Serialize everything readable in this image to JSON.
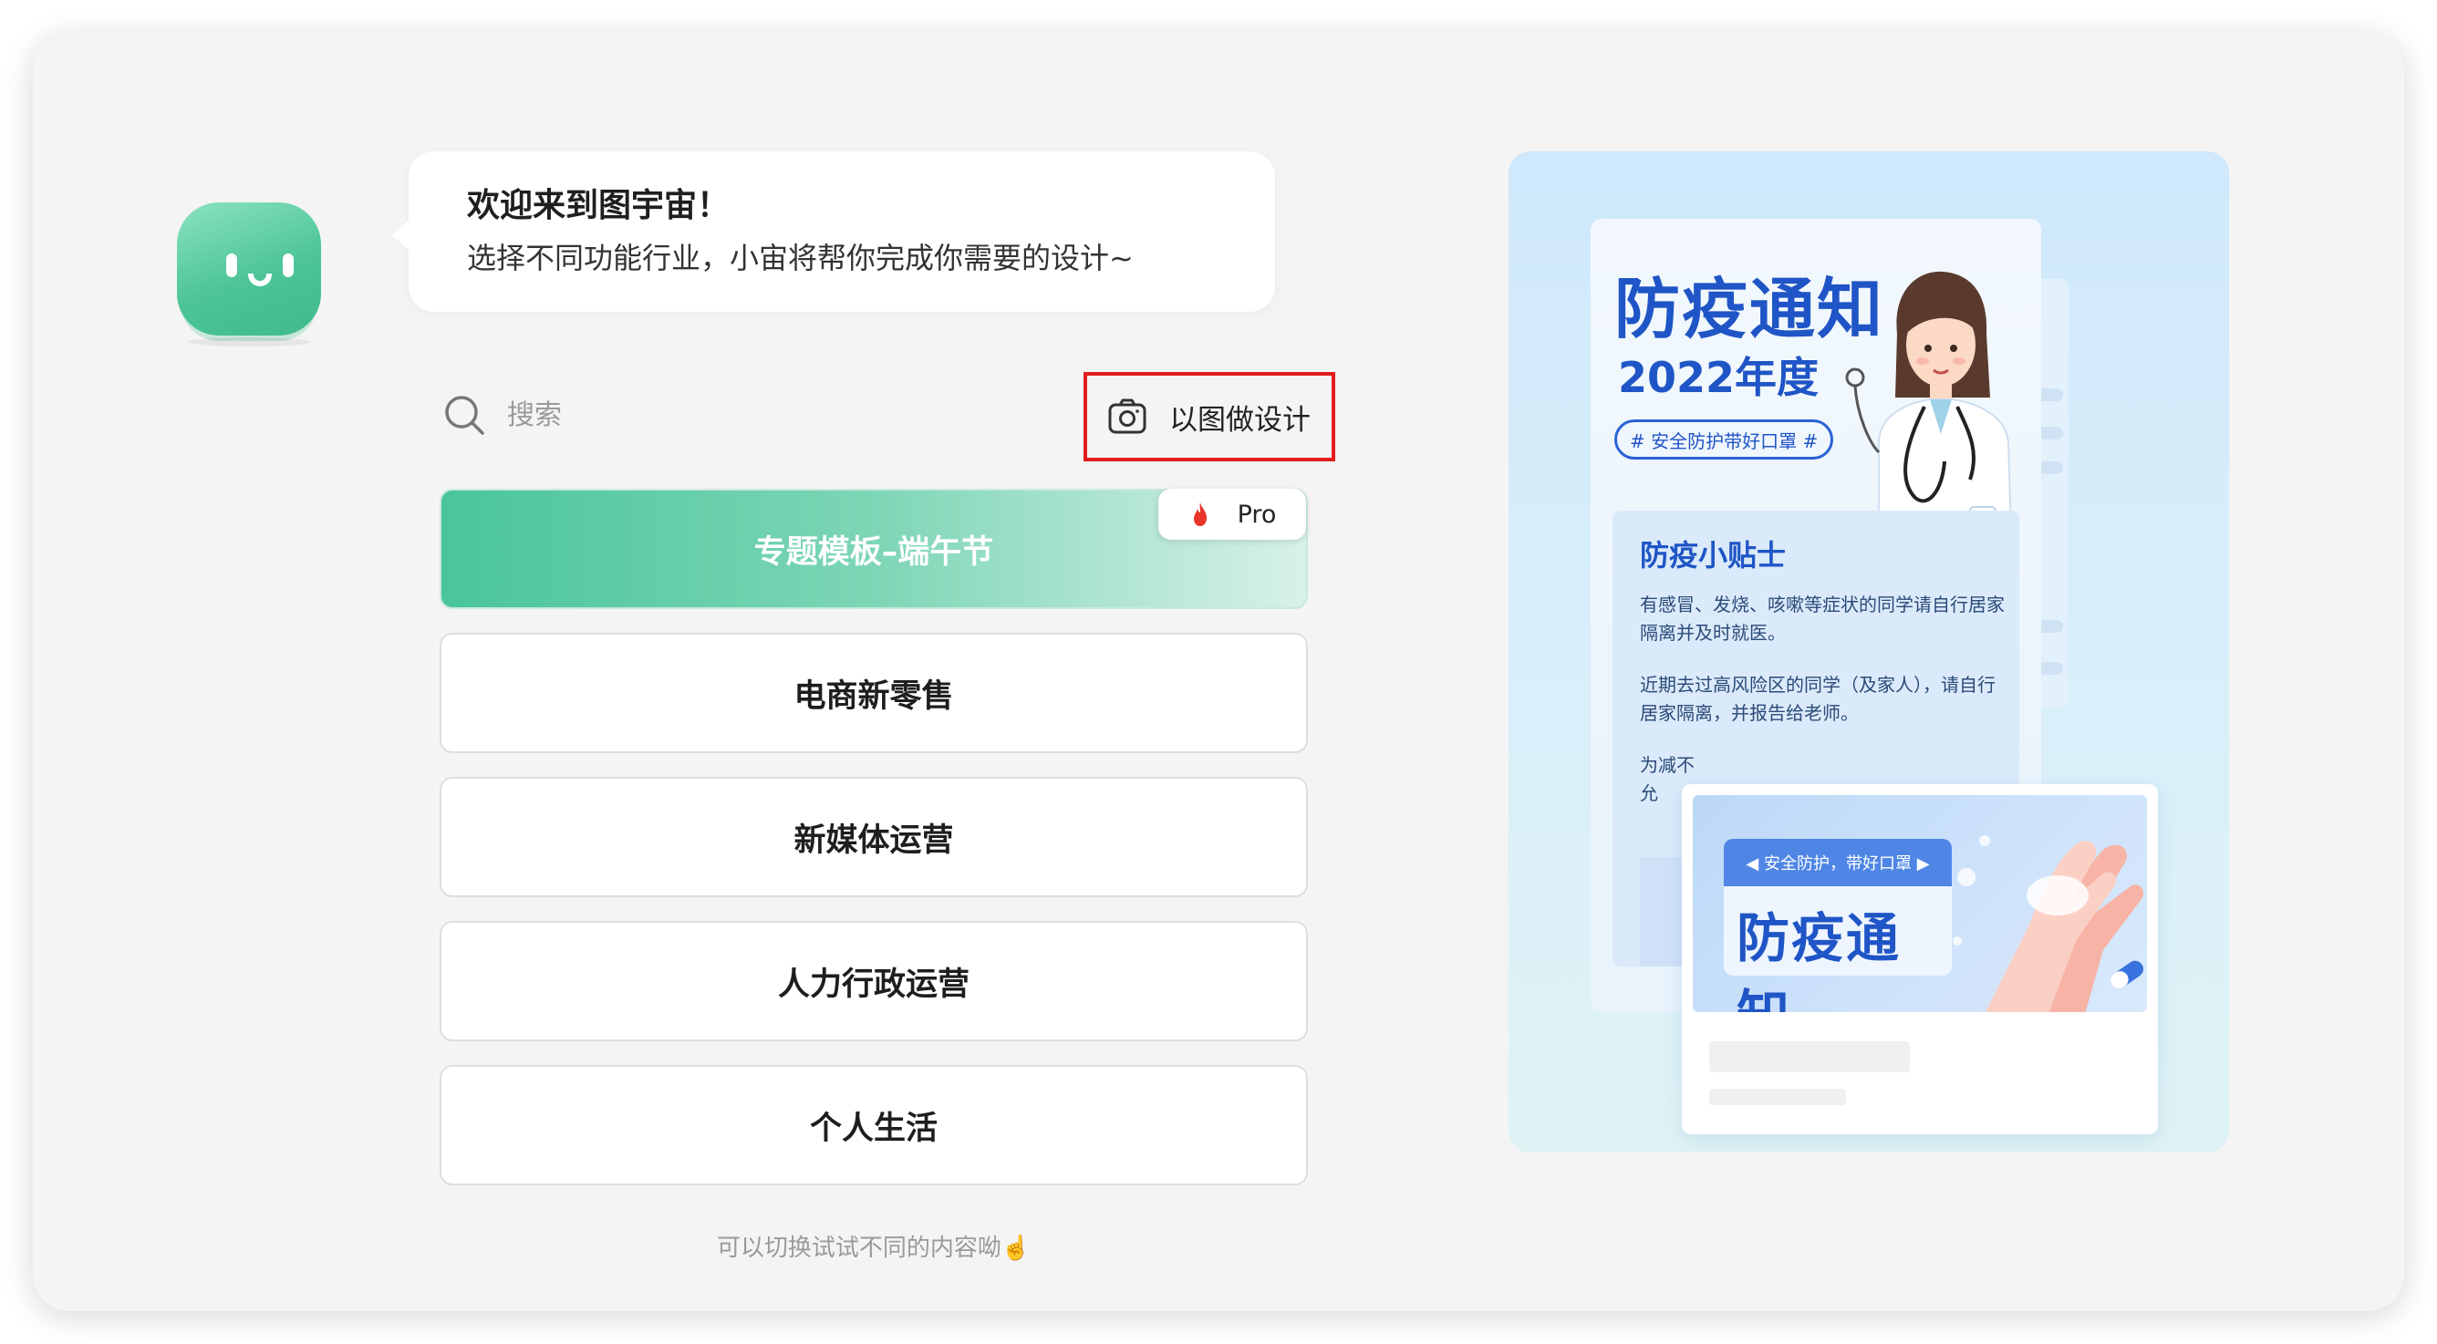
{
  "welcome": {
    "title": "欢迎来到图宇宙！",
    "subtitle": "选择不同功能行业，小宙将帮你完成你需要的设计~"
  },
  "search": {
    "placeholder": "搜索",
    "value": ""
  },
  "image_design": {
    "label": "以图做设计",
    "icon": "camera-icon"
  },
  "categories": [
    {
      "label": "专题模板–端午节",
      "featured": true,
      "badge": "Pro"
    },
    {
      "label": "电商新零售"
    },
    {
      "label": "新媒体运营"
    },
    {
      "label": "人力行政运营"
    },
    {
      "label": "个人生活"
    }
  ],
  "hint": "可以切换试试不同的内容呦☝️",
  "preview": {
    "poster_title": "防疫通知",
    "poster_year": "2022年度",
    "poster_tag": "# 安全防护带好口罩 #",
    "tips_title": "防疫小贴士",
    "tips_p1": "有感冒、发烧、咳嗽等症状的同学请自行居家隔离并及时就医。",
    "tips_p2": "近期去过高风险区的同学（及家人），请自行居家隔离，并报告给老师。",
    "tips_p3": "为减不允",
    "front_label_top": "◀ 安全防护，带好口罩 ▶",
    "front_label_title": "防疫通知"
  },
  "colors": {
    "accent_green": "#49c59a",
    "highlight_red": "#e21c1c",
    "poster_blue": "#1f55c6"
  }
}
